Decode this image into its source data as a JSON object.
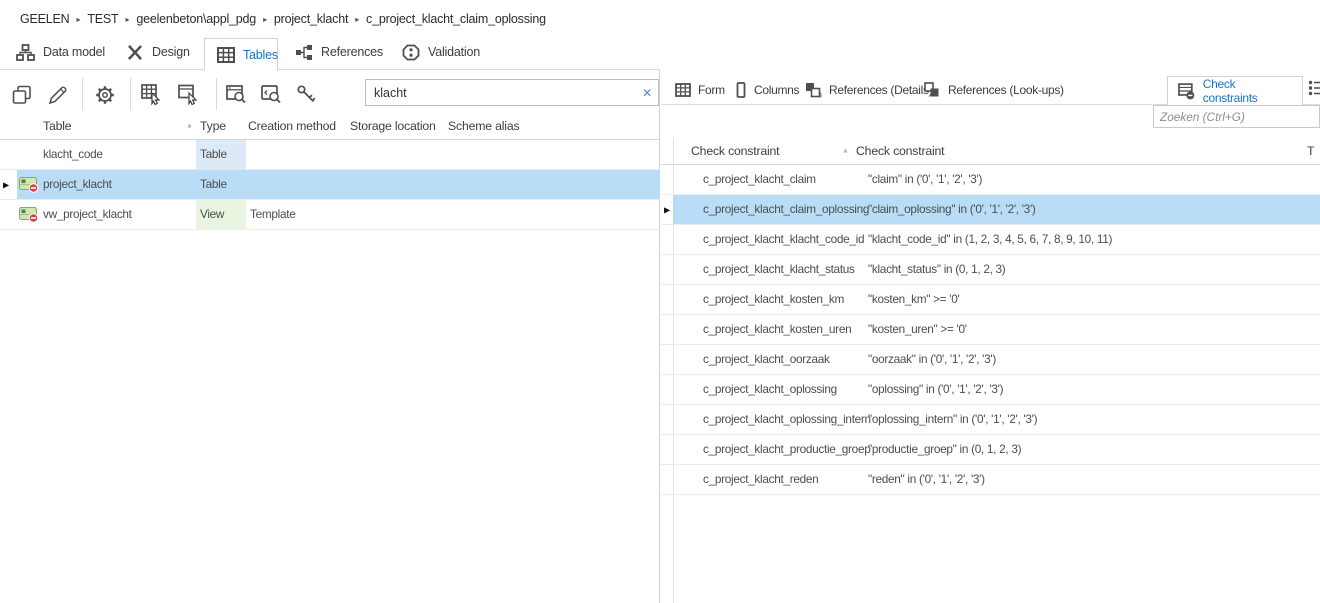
{
  "breadcrumb": {
    "items": [
      "GEELEN",
      "TEST",
      "geelenbeton\\appl_pdg",
      "project_klacht",
      "c_project_klacht_claim_oplossing"
    ]
  },
  "main_tabs": [
    {
      "label": "Data model",
      "icon": "data-model-icon",
      "active": false
    },
    {
      "label": "Design",
      "icon": "design-icon",
      "active": false
    },
    {
      "label": "Tables",
      "icon": "tables-icon",
      "active": true
    },
    {
      "label": "References",
      "icon": "references-icon",
      "active": false
    },
    {
      "label": "Validation",
      "icon": "validation-icon",
      "active": false
    }
  ],
  "left_panel": {
    "toolbar_icons": [
      "copy-icon",
      "edit-pencil-icon",
      "gear-icon",
      "table-cursor-icon",
      "window-cursor-icon",
      "window-search-icon",
      "window-code-search-icon",
      "key-icon"
    ],
    "search": {
      "value": "klacht",
      "clear_label": "✕"
    },
    "grid": {
      "columns": [
        "Table",
        "Type",
        "Creation method",
        "Storage location",
        "Scheme alias"
      ],
      "sorted_column": "Table",
      "sort_glyph": "▲",
      "rows": [
        {
          "name": "klacht_code",
          "type": "Table",
          "creation_method": "",
          "has_icon": false,
          "selected": false
        },
        {
          "name": "project_klacht",
          "type": "Table",
          "creation_method": "",
          "has_icon": true,
          "selected": true
        },
        {
          "name": "vw_project_klacht",
          "type": "View",
          "creation_method": "Template",
          "has_icon": true,
          "selected": false
        }
      ]
    }
  },
  "right_panel": {
    "tabs": [
      {
        "label": "Form",
        "icon": "form-icon",
        "active": false
      },
      {
        "label": "Columns",
        "icon": "columns-icon",
        "active": false
      },
      {
        "label": "References (Details)",
        "icon": "references-details-icon",
        "active": false
      },
      {
        "label": "References (Look-ups)",
        "icon": "references-lookups-icon",
        "active": false
      },
      {
        "label": "Check constraints",
        "icon": "check-constraints-icon",
        "active": true
      }
    ],
    "search": {
      "placeholder": "Zoeken (Ctrl+G)"
    },
    "grid": {
      "columns": [
        "Check constraint",
        "Check constraint",
        "T"
      ],
      "sorted_column": "Check constraint",
      "sort_glyph": "▲",
      "rows": [
        {
          "name": "c_project_klacht_claim",
          "definition": "\"claim\" in ('0', '1', '2', '3')",
          "selected": false
        },
        {
          "name": "c_project_klacht_claim_oplossing",
          "definition": "\"claim_oplossing\" in ('0', '1', '2', '3')",
          "selected": true
        },
        {
          "name": "c_project_klacht_klacht_code_id",
          "definition": "\"klacht_code_id\" in (1, 2, 3, 4, 5, 6, 7, 8, 9, 10, 11)",
          "selected": false
        },
        {
          "name": "c_project_klacht_klacht_status",
          "definition": "\"klacht_status\" in (0, 1, 2, 3)",
          "selected": false
        },
        {
          "name": "c_project_klacht_kosten_km",
          "definition": "\"kosten_km\" >= '0'",
          "selected": false
        },
        {
          "name": "c_project_klacht_kosten_uren",
          "definition": "\"kosten_uren\" >= '0'",
          "selected": false
        },
        {
          "name": "c_project_klacht_oorzaak",
          "definition": "\"oorzaak\" in ('0', '1', '2', '3')",
          "selected": false
        },
        {
          "name": "c_project_klacht_oplossing",
          "definition": "\"oplossing\" in ('0', '1', '2', '3')",
          "selected": false
        },
        {
          "name": "c_project_klacht_oplossing_intern",
          "definition": "\"oplossing_intern\" in ('0', '1', '2', '3')",
          "selected": false
        },
        {
          "name": "c_project_klacht_productie_groep",
          "definition": "\"productie_groep\" in (0, 1, 2, 3)",
          "selected": false
        },
        {
          "name": "c_project_klacht_reden",
          "definition": "\"reden\" in ('0', '1', '2', '3')",
          "selected": false
        }
      ]
    }
  },
  "colors": {
    "accent_blue": "#1874c4",
    "selection_blue": "#b9ddf7",
    "type_table_bg": "#dce9f7",
    "type_view_bg": "#e9f4e1",
    "row_icon_green": "#cde8b5",
    "badge_red": "#d64541"
  }
}
